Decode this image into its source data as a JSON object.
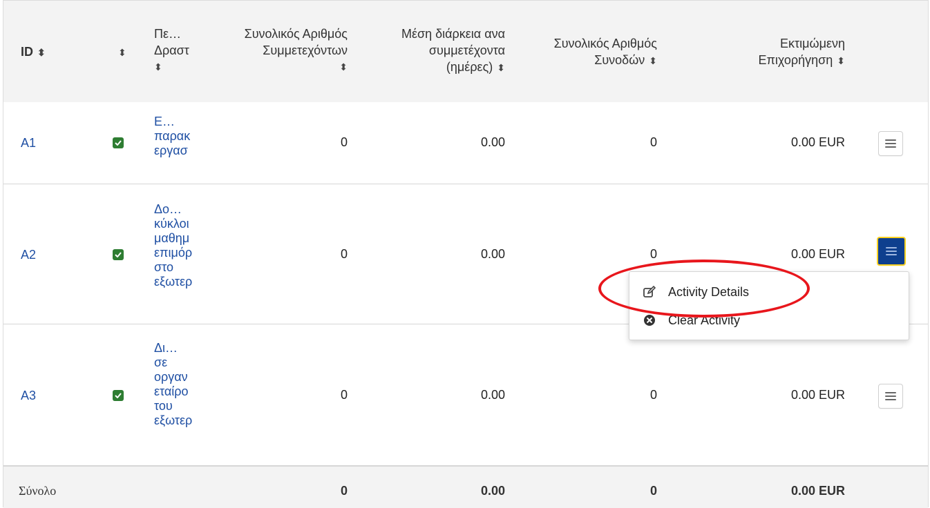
{
  "header": {
    "id": "ID",
    "sort_glyph": "⬍",
    "title_line1": "Πε…",
    "title_line2": "Δραστ",
    "participants_line1": "Συνολικός Αριθμός",
    "participants_line2": "Συμμετεχόντων",
    "duration_line1": "Μέση διάρκεια ανα",
    "duration_line2": "συμμετέχοντα",
    "duration_line3": "(ημέρες)",
    "companions_line1": "Συνολικός Αριθμός",
    "companions_line2": "Συνοδών",
    "grant_line1": "Εκτιμώμενη",
    "grant_line2": "Επιχορήγηση"
  },
  "rows": [
    {
      "id": "A1",
      "title_lines": [
        "Ε…",
        "παρακ",
        "εργασ"
      ],
      "participants": "0",
      "duration": "0.00",
      "companions": "0",
      "grant": "0.00 EUR"
    },
    {
      "id": "A2",
      "title_lines": [
        "Δο…",
        "κύκλοι",
        "μαθημ",
        "επιμόρ",
        "στο",
        "εξωτερ"
      ],
      "participants": "0",
      "duration": "0.00",
      "companions": "0",
      "grant": "0.00 EUR"
    },
    {
      "id": "A3",
      "title_lines": [
        "Δι…",
        "σε",
        "οργαν",
        "εταίρο",
        "του",
        "εξωτερ"
      ],
      "participants": "0",
      "duration": "0.00",
      "companions": "0",
      "grant": "0.00 EUR"
    }
  ],
  "footer": {
    "label": "Σύνολο",
    "participants": "0",
    "duration": "0.00",
    "companions": "0",
    "grant": "0.00 EUR"
  },
  "dropdown": {
    "activity_details": "Activity Details",
    "clear_activity": "Clear Activity"
  },
  "colors": {
    "link": "#1f4fa3",
    "check": "#2e7d32",
    "active_button": "#0e3f8e",
    "focus_ring": "#ffd21f",
    "annotation": "#e8161c"
  }
}
